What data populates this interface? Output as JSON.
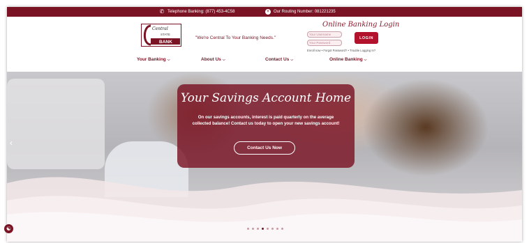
{
  "topbar": {
    "phone_icon": "phone-icon",
    "phone_text": "Telephone Banking: (877) 453-4C58",
    "routing_icon": "plus-circle-icon",
    "routing_text": "Our Routing Number: 081221235"
  },
  "brand": {
    "logo_line1": "Central",
    "logo_line2": "STATE",
    "logo_line3": "BANK",
    "tagline": "\"We're Central To Your Banking Needs.\"",
    "colors": {
      "primary": "#7a1324",
      "button": "#b3122c"
    }
  },
  "login": {
    "title": "Online Banking Login",
    "username_placeholder": "Your Username",
    "password_placeholder": "Your Password",
    "button_label": "LOGIN",
    "links": "Enroll now • Forgot Password? • Trouble Logging In?"
  },
  "nav": {
    "items": [
      {
        "label": "Your Banking"
      },
      {
        "label": "About Us"
      },
      {
        "label": "Contact Us"
      },
      {
        "label": "Online Banking"
      }
    ],
    "chevron": "chevron-down-icon"
  },
  "hero": {
    "title": "Your Savings Account Home",
    "text": "On our savings accounts, interest is paid quarterly on the average collected balance! Contact us today to open your new savings account!",
    "button_label": "Contact Us Now",
    "prev_icon": "chevron-left-icon",
    "slides": 8,
    "active_slide": 4
  },
  "accessibility_icon": "accessibility-icon"
}
